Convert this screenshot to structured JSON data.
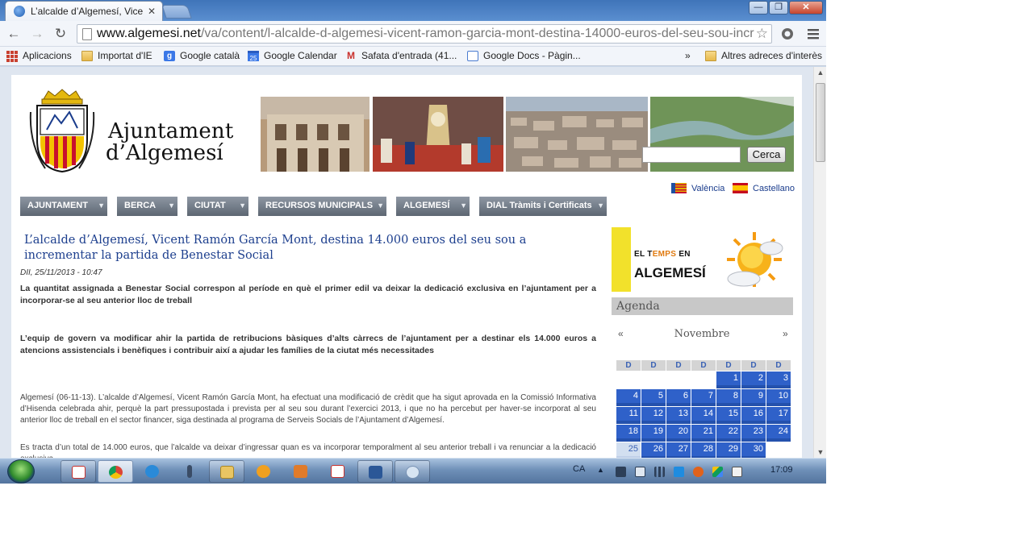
{
  "browser": {
    "tab_title": "L’alcalde d’Algemesí, Vice",
    "tab_close": "✕",
    "window_minimize": "—",
    "window_maximize": "❐",
    "window_close": "✕",
    "url_domain": "www.algemesi.net",
    "url_path": "/va/content/l-alcalde-d-algemesi-vicent-ramon-garcia-mont-destina-14000-euros-del-seu-sou-incr",
    "nav_back": "←",
    "nav_forward": "→",
    "nav_reload": "↻",
    "star": "☆"
  },
  "bookmarks": {
    "items": [
      {
        "label": "Aplicacions",
        "icon": "apps-grid-icon"
      },
      {
        "label": "Importat d'IE",
        "icon": "folder-icon"
      },
      {
        "label": "Google català",
        "icon": "google-icon"
      },
      {
        "label": "Google Calendar",
        "icon": "calendar-icon"
      },
      {
        "label": "Safata d'entrada (41...",
        "icon": "gmail-icon"
      },
      {
        "label": "Google Docs - Pàgin...",
        "icon": "docs-icon"
      }
    ],
    "overflow": "»",
    "other": "Altres adreces d'interès",
    "calendar_day": "25",
    "google_letter": "g",
    "gmail_letter": "M"
  },
  "site": {
    "brand_line1": "Ajuntament",
    "brand_line2": "d’Algemesí",
    "search_button": "Cerca",
    "search_value": "",
    "languages": [
      "València",
      "Castellano"
    ],
    "menu": [
      "AJUNTAMENT",
      "BERCA",
      "CIUTAT",
      "RECURSOS MUNICIPALS",
      "ALGEMESÍ",
      "DIAL Tràmits i Certificats"
    ],
    "menu_caret": "▼"
  },
  "article": {
    "title": "L’alcalde d’Algemesí, Vicent Ramón García Mont, destina 14.000 euros del seu sou a incrementar la partida de Benestar Social",
    "date": "DII, 25/11/2013 - 10:47",
    "lead": "La quantitat assignada a Benestar Social correspon al període en què el primer edil va deixar la dedicació exclusiva en l’ajuntament per a incorporar-se al seu anterior lloc de treball",
    "subtitle": "L’equip de govern va modificar ahir la partida de retribucions bàsiques d’alts càrrecs de l’ajuntament per a destinar els 14.000 euros a atencions assistencials i benèfiques i contribuir així a ajudar les famílies de la ciutat més necessitades",
    "body1": "Algemesí (06-11-13). L’alcalde d’Algemesí, Vicent Ramón García Mont, ha efectuat una modificació de crèdit que ha sigut aprovada en la Comissió Informativa d’Hisenda celebrada ahir, perquè la part pressupostada i prevista per al seu sou durant l’exercici 2013, i que no ha percebut per haver-se incorporat al seu anterior lloc de treball en el sector financer, siga destinada al programa de Serveis Socials de l’Ajuntament d’Algemesí.",
    "body2": "Es tracta d’un total de 14.000 euros, que l’alcalde va deixar d’ingressar quan es va incorporar temporalment al seu anterior treball i va renunciar a la dedicació exclusiva."
  },
  "weather": {
    "line1_prefix": "EL T",
    "line1_highlight": "EMPS",
    "line1_suffix": " EN",
    "line2": "ALGEMESÍ"
  },
  "agenda": {
    "title": "Agenda",
    "month": "Novembre",
    "prev": "«",
    "next": "»",
    "weekdays": [
      "D",
      "D",
      "D",
      "D",
      "D",
      "D",
      "D"
    ],
    "weeks": [
      [
        "",
        "",
        "",
        "",
        "1",
        "2",
        "3"
      ],
      [
        "4",
        "5",
        "6",
        "7",
        "8",
        "9",
        "10"
      ],
      [
        "11",
        "12",
        "13",
        "14",
        "15",
        "16",
        "17"
      ],
      [
        "18",
        "19",
        "20",
        "21",
        "22",
        "23",
        "24"
      ],
      [
        "25",
        "26",
        "27",
        "28",
        "29",
        "30",
        ""
      ]
    ],
    "today": "25"
  },
  "taskbar": {
    "language": "CA",
    "clock": "17:09",
    "apps": [
      "gmail-app-icon",
      "chrome-app-icon",
      "ie-app-icon",
      "tool-app-icon",
      "explorer-app-icon",
      "media-app-icon",
      "stack-app-icon",
      "pdf-app-icon",
      "word-app-icon",
      "paint-app-icon"
    ],
    "tray_arrow": "▲"
  },
  "colors": {
    "link_blue": "#1d3f8e",
    "menu_gray": "#6b737e",
    "calendar_blue": "#2f61c9",
    "weather_yellow": "#f2e12b"
  }
}
